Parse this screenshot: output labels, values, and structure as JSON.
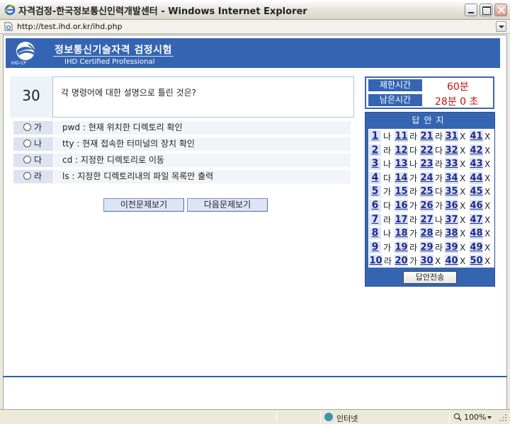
{
  "window": {
    "title": "자격검정-한국정보통신인력개발센터 - Windows Internet Explorer"
  },
  "address": {
    "url": "http://test.ihd.or.kr/ihd.php"
  },
  "banner": {
    "title": "정보통신기술자격 검정시험",
    "subtitle": "IHD Certified Professional",
    "logo_text": "IHD-CP"
  },
  "question": {
    "number": "30",
    "text": "각 명령어에 대한 설명으로 틀린 것은?"
  },
  "options": [
    {
      "label": "가",
      "text": "pwd : 현재 위치한 디렉토리 확인"
    },
    {
      "label": "나",
      "text": "tty : 현재 접속한 터미널의 장치 확인"
    },
    {
      "label": "다",
      "text": "cd : 지정한 디렉토리로 이동"
    },
    {
      "label": "라",
      "text": "ls : 지정한 디렉토리내의 파일 목록만 출력"
    }
  ],
  "nav": {
    "prev": "이전문제보기",
    "next": "다음문제보기"
  },
  "timer": {
    "limit_label": "제한시간",
    "limit_value": "60분",
    "remain_label": "남은시간",
    "remain_value": "28분 0 초"
  },
  "answer_sheet": {
    "title": "답안지",
    "submit": "답안전송",
    "answers": [
      {
        "n": "1",
        "a": "나"
      },
      {
        "n": "2",
        "a": "라"
      },
      {
        "n": "3",
        "a": "나"
      },
      {
        "n": "4",
        "a": "다"
      },
      {
        "n": "5",
        "a": "가"
      },
      {
        "n": "6",
        "a": "다"
      },
      {
        "n": "7",
        "a": "라"
      },
      {
        "n": "8",
        "a": "나"
      },
      {
        "n": "9",
        "a": "가"
      },
      {
        "n": "10",
        "a": "라"
      },
      {
        "n": "11",
        "a": "라"
      },
      {
        "n": "12",
        "a": "다"
      },
      {
        "n": "13",
        "a": "나"
      },
      {
        "n": "14",
        "a": "가"
      },
      {
        "n": "15",
        "a": "라"
      },
      {
        "n": "16",
        "a": "가"
      },
      {
        "n": "17",
        "a": "라"
      },
      {
        "n": "18",
        "a": "가"
      },
      {
        "n": "19",
        "a": "라"
      },
      {
        "n": "20",
        "a": "가"
      },
      {
        "n": "21",
        "a": "라"
      },
      {
        "n": "22",
        "a": "다"
      },
      {
        "n": "23",
        "a": "라"
      },
      {
        "n": "24",
        "a": "가"
      },
      {
        "n": "25",
        "a": "다"
      },
      {
        "n": "26",
        "a": "가"
      },
      {
        "n": "27",
        "a": "나"
      },
      {
        "n": "28",
        "a": "라"
      },
      {
        "n": "29",
        "a": "라"
      },
      {
        "n": "30",
        "a": "X"
      },
      {
        "n": "31",
        "a": "X"
      },
      {
        "n": "32",
        "a": "X"
      },
      {
        "n": "33",
        "a": "X"
      },
      {
        "n": "34",
        "a": "X"
      },
      {
        "n": "35",
        "a": "X"
      },
      {
        "n": "36",
        "a": "X"
      },
      {
        "n": "37",
        "a": "X"
      },
      {
        "n": "38",
        "a": "X"
      },
      {
        "n": "39",
        "a": "X"
      },
      {
        "n": "40",
        "a": "X"
      },
      {
        "n": "41",
        "a": "X"
      },
      {
        "n": "42",
        "a": "X"
      },
      {
        "n": "43",
        "a": "X"
      },
      {
        "n": "44",
        "a": "X"
      },
      {
        "n": "45",
        "a": "X"
      },
      {
        "n": "46",
        "a": "X"
      },
      {
        "n": "47",
        "a": "X"
      },
      {
        "n": "48",
        "a": "X"
      },
      {
        "n": "49",
        "a": "X"
      },
      {
        "n": "50",
        "a": "X"
      }
    ]
  },
  "status": {
    "zone": "인터넷",
    "zoom": "100%"
  },
  "icons": {
    "browser": "ie-icon",
    "page": "page-icon",
    "zone": "globe-icon",
    "zoom": "zoom-icon"
  },
  "colors": {
    "brand": "#3565b2",
    "timer_value": "#c01212",
    "answer_number": "#1a2a8c",
    "option_bg": "#dde3f1"
  }
}
